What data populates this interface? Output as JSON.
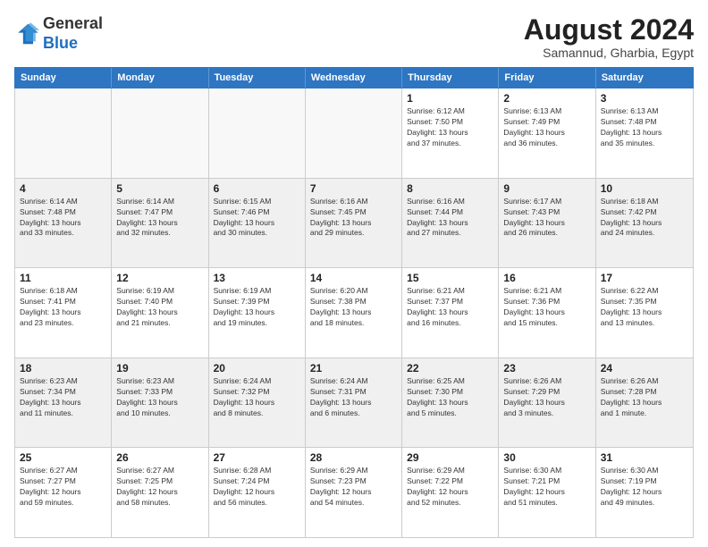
{
  "logo": {
    "general": "General",
    "blue": "Blue"
  },
  "title": "August 2024",
  "subtitle": "Samannud, Gharbia, Egypt",
  "headers": [
    "Sunday",
    "Monday",
    "Tuesday",
    "Wednesday",
    "Thursday",
    "Friday",
    "Saturday"
  ],
  "weeks": [
    [
      {
        "day": "",
        "text": "",
        "empty": true
      },
      {
        "day": "",
        "text": "",
        "empty": true
      },
      {
        "day": "",
        "text": "",
        "empty": true
      },
      {
        "day": "",
        "text": "",
        "empty": true
      },
      {
        "day": "1",
        "text": "Sunrise: 6:12 AM\nSunset: 7:50 PM\nDaylight: 13 hours\nand 37 minutes.",
        "empty": false
      },
      {
        "day": "2",
        "text": "Sunrise: 6:13 AM\nSunset: 7:49 PM\nDaylight: 13 hours\nand 36 minutes.",
        "empty": false
      },
      {
        "day": "3",
        "text": "Sunrise: 6:13 AM\nSunset: 7:48 PM\nDaylight: 13 hours\nand 35 minutes.",
        "empty": false
      }
    ],
    [
      {
        "day": "4",
        "text": "Sunrise: 6:14 AM\nSunset: 7:48 PM\nDaylight: 13 hours\nand 33 minutes.",
        "empty": false
      },
      {
        "day": "5",
        "text": "Sunrise: 6:14 AM\nSunset: 7:47 PM\nDaylight: 13 hours\nand 32 minutes.",
        "empty": false
      },
      {
        "day": "6",
        "text": "Sunrise: 6:15 AM\nSunset: 7:46 PM\nDaylight: 13 hours\nand 30 minutes.",
        "empty": false
      },
      {
        "day": "7",
        "text": "Sunrise: 6:16 AM\nSunset: 7:45 PM\nDaylight: 13 hours\nand 29 minutes.",
        "empty": false
      },
      {
        "day": "8",
        "text": "Sunrise: 6:16 AM\nSunset: 7:44 PM\nDaylight: 13 hours\nand 27 minutes.",
        "empty": false
      },
      {
        "day": "9",
        "text": "Sunrise: 6:17 AM\nSunset: 7:43 PM\nDaylight: 13 hours\nand 26 minutes.",
        "empty": false
      },
      {
        "day": "10",
        "text": "Sunrise: 6:18 AM\nSunset: 7:42 PM\nDaylight: 13 hours\nand 24 minutes.",
        "empty": false
      }
    ],
    [
      {
        "day": "11",
        "text": "Sunrise: 6:18 AM\nSunset: 7:41 PM\nDaylight: 13 hours\nand 23 minutes.",
        "empty": false
      },
      {
        "day": "12",
        "text": "Sunrise: 6:19 AM\nSunset: 7:40 PM\nDaylight: 13 hours\nand 21 minutes.",
        "empty": false
      },
      {
        "day": "13",
        "text": "Sunrise: 6:19 AM\nSunset: 7:39 PM\nDaylight: 13 hours\nand 19 minutes.",
        "empty": false
      },
      {
        "day": "14",
        "text": "Sunrise: 6:20 AM\nSunset: 7:38 PM\nDaylight: 13 hours\nand 18 minutes.",
        "empty": false
      },
      {
        "day": "15",
        "text": "Sunrise: 6:21 AM\nSunset: 7:37 PM\nDaylight: 13 hours\nand 16 minutes.",
        "empty": false
      },
      {
        "day": "16",
        "text": "Sunrise: 6:21 AM\nSunset: 7:36 PM\nDaylight: 13 hours\nand 15 minutes.",
        "empty": false
      },
      {
        "day": "17",
        "text": "Sunrise: 6:22 AM\nSunset: 7:35 PM\nDaylight: 13 hours\nand 13 minutes.",
        "empty": false
      }
    ],
    [
      {
        "day": "18",
        "text": "Sunrise: 6:23 AM\nSunset: 7:34 PM\nDaylight: 13 hours\nand 11 minutes.",
        "empty": false
      },
      {
        "day": "19",
        "text": "Sunrise: 6:23 AM\nSunset: 7:33 PM\nDaylight: 13 hours\nand 10 minutes.",
        "empty": false
      },
      {
        "day": "20",
        "text": "Sunrise: 6:24 AM\nSunset: 7:32 PM\nDaylight: 13 hours\nand 8 minutes.",
        "empty": false
      },
      {
        "day": "21",
        "text": "Sunrise: 6:24 AM\nSunset: 7:31 PM\nDaylight: 13 hours\nand 6 minutes.",
        "empty": false
      },
      {
        "day": "22",
        "text": "Sunrise: 6:25 AM\nSunset: 7:30 PM\nDaylight: 13 hours\nand 5 minutes.",
        "empty": false
      },
      {
        "day": "23",
        "text": "Sunrise: 6:26 AM\nSunset: 7:29 PM\nDaylight: 13 hours\nand 3 minutes.",
        "empty": false
      },
      {
        "day": "24",
        "text": "Sunrise: 6:26 AM\nSunset: 7:28 PM\nDaylight: 13 hours\nand 1 minute.",
        "empty": false
      }
    ],
    [
      {
        "day": "25",
        "text": "Sunrise: 6:27 AM\nSunset: 7:27 PM\nDaylight: 12 hours\nand 59 minutes.",
        "empty": false
      },
      {
        "day": "26",
        "text": "Sunrise: 6:27 AM\nSunset: 7:25 PM\nDaylight: 12 hours\nand 58 minutes.",
        "empty": false
      },
      {
        "day": "27",
        "text": "Sunrise: 6:28 AM\nSunset: 7:24 PM\nDaylight: 12 hours\nand 56 minutes.",
        "empty": false
      },
      {
        "day": "28",
        "text": "Sunrise: 6:29 AM\nSunset: 7:23 PM\nDaylight: 12 hours\nand 54 minutes.",
        "empty": false
      },
      {
        "day": "29",
        "text": "Sunrise: 6:29 AM\nSunset: 7:22 PM\nDaylight: 12 hours\nand 52 minutes.",
        "empty": false
      },
      {
        "day": "30",
        "text": "Sunrise: 6:30 AM\nSunset: 7:21 PM\nDaylight: 12 hours\nand 51 minutes.",
        "empty": false
      },
      {
        "day": "31",
        "text": "Sunrise: 6:30 AM\nSunset: 7:19 PM\nDaylight: 12 hours\nand 49 minutes.",
        "empty": false
      }
    ]
  ]
}
